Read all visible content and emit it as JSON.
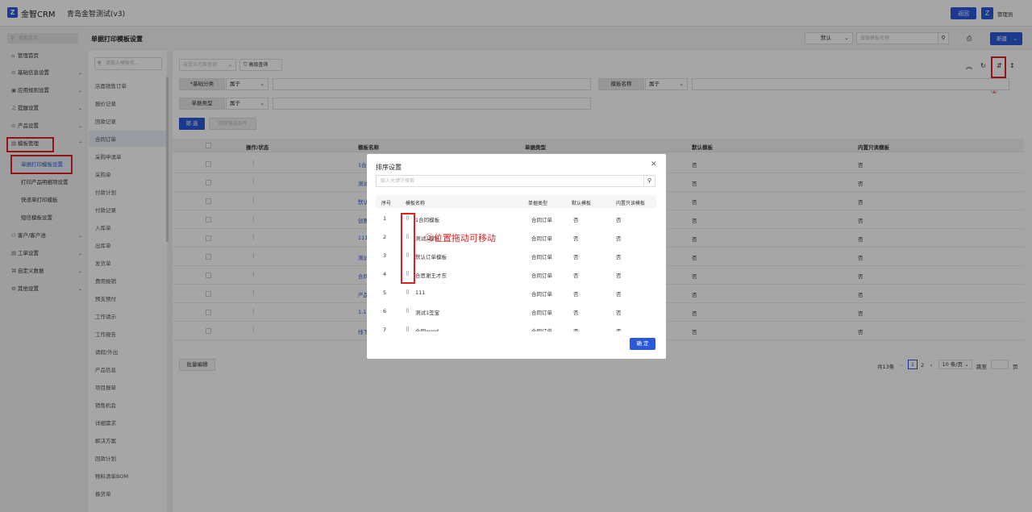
{
  "topbar": {
    "logo_glyph": "Z",
    "brand": "金智CRM",
    "app_title": "青岛金智测试(v3)",
    "back_button": "返回",
    "user_name": "管理员"
  },
  "sidebar": {
    "search_placeholder": "搜索菜单",
    "items": [
      {
        "icon": "⌂",
        "label": "管理首页"
      },
      {
        "icon": "⊙",
        "label": "基础信息设置"
      },
      {
        "icon": "▣",
        "label": "应用规则设置"
      },
      {
        "icon": "♫",
        "label": "提醒设置"
      },
      {
        "icon": "⊙",
        "label": "产品设置"
      },
      {
        "icon": "▤",
        "label": "模板管理"
      }
    ],
    "sub_items": [
      "单据打印模板设置",
      "打印产品明细项设置",
      "快递单打印模板",
      "短信模板设置"
    ],
    "items_after": [
      {
        "icon": "⚇",
        "label": "客户/客户池"
      },
      {
        "icon": "▤",
        "label": "工单设置"
      },
      {
        "icon": "⌘",
        "label": "自定义数据"
      },
      {
        "icon": "⚙",
        "label": "其他设置"
      }
    ]
  },
  "page": {
    "title": "单据打印模板设置",
    "default_select": "默认",
    "template_search_placeholder": "搜索模板名称",
    "new_button": "新建"
  },
  "doc_list": {
    "search_placeholder": "请输入模板名...",
    "items": [
      "店面销售订单",
      "报价记录",
      "回款记录",
      "合同订单",
      "采购申请单",
      "采购单",
      "付款计划",
      "付款记录",
      "入库单",
      "出库单",
      "发货单",
      "费用报销",
      "预支预付",
      "工作请示",
      "工作报告",
      "请假/外出",
      "产品信息",
      "项目报单",
      "销售机会",
      "详细需求",
      "解决方案",
      "回款计划",
      "物料清单BOM",
      "换货单"
    ],
    "active": "合同订单"
  },
  "filters": {
    "custom_query": "自定义方案查询",
    "advanced": "高级查询",
    "base_category_label": "*基础分类",
    "template_name_label": "模板名称",
    "doc_type_label": "单据类型",
    "belongs": "属于",
    "filter_button": "筛 选",
    "clear_button": "清除筛选条件"
  },
  "table": {
    "headers": [
      "操作/状态",
      "模板名称",
      "单据类型",
      "默认模板",
      "内置只读模板"
    ],
    "row_names": [
      "1合",
      "测试",
      "默认",
      "创图",
      "111",
      "测试",
      "合同",
      "产品",
      "1.1",
      "线下"
    ],
    "default_value": "否",
    "readonly_value": "否",
    "batch_edit": "批量编辑"
  },
  "pagination": {
    "total": "共13条",
    "page1": "1",
    "page2": "2",
    "per_page": "10 条/页",
    "jump_label": "跳至",
    "page_suffix": "页"
  },
  "modal": {
    "title": "排序设置",
    "search_placeholder": "输入关键字搜索",
    "headers": [
      "序号",
      "模板名称",
      "单据类型",
      "默认模板",
      "内置只读模板"
    ],
    "rows": [
      {
        "no": "1",
        "name": "1合同模板",
        "type": "合同订单",
        "default": "否",
        "readonly": "否"
      },
      {
        "no": "2",
        "name": "测试1模板",
        "type": "合同订单",
        "default": "否",
        "readonly": "否"
      },
      {
        "no": "3",
        "name": "默认订单模板",
        "type": "合同订单",
        "default": "否",
        "readonly": "否"
      },
      {
        "no": "4",
        "name": "合思谢王才东",
        "type": "合同订单",
        "default": "否",
        "readonly": "否"
      },
      {
        "no": "5",
        "name": "111",
        "type": "合同订单",
        "default": "否",
        "readonly": "否"
      },
      {
        "no": "6",
        "name": "测试1签宝",
        "type": "合同订单",
        "default": "否",
        "readonly": "否"
      },
      {
        "no": "7",
        "name": "合同word",
        "type": "合同订单",
        "default": "否",
        "readonly": "否"
      }
    ],
    "confirm_button": "确 定"
  },
  "annotations": {
    "marker1": "①",
    "marker2": "②位置拖动可移动"
  },
  "colors": {
    "accent": "#2b59d9",
    "annotation_red": "#e02020"
  }
}
